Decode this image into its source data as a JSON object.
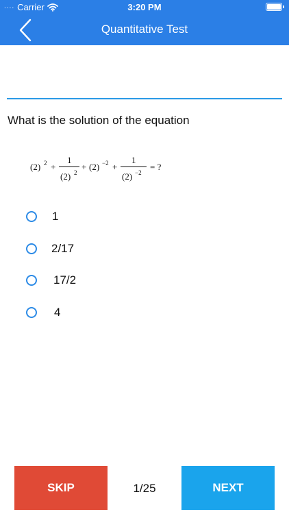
{
  "status_bar": {
    "carrier": "Carrier",
    "time": "3:20 PM",
    "signal_dots": "....",
    "signal_icon": "wifi-icon",
    "battery_icon": "battery-icon"
  },
  "nav": {
    "title": "Quantitative Test",
    "back_icon": "chevron-left-icon"
  },
  "colors": {
    "header": "#2b7fe6",
    "divider": "#2b9ae6",
    "radio": "#2b8ae6",
    "skip": "#e04a36",
    "next": "#1aa4ec"
  },
  "question": {
    "text": "What is the solution of the equation",
    "equation": {
      "base": "(2)",
      "exp_pos": "2",
      "exp_neg": "−2",
      "numerator": "1",
      "plus": "+",
      "equals": "= ?"
    }
  },
  "options": [
    {
      "label": "1",
      "selected": false
    },
    {
      "label": "2/17",
      "selected": false
    },
    {
      "label": "17/2",
      "selected": false
    },
    {
      "label": "4",
      "selected": false
    }
  ],
  "footer": {
    "skip_label": "SKIP",
    "next_label": "NEXT",
    "progress": "1/25"
  }
}
